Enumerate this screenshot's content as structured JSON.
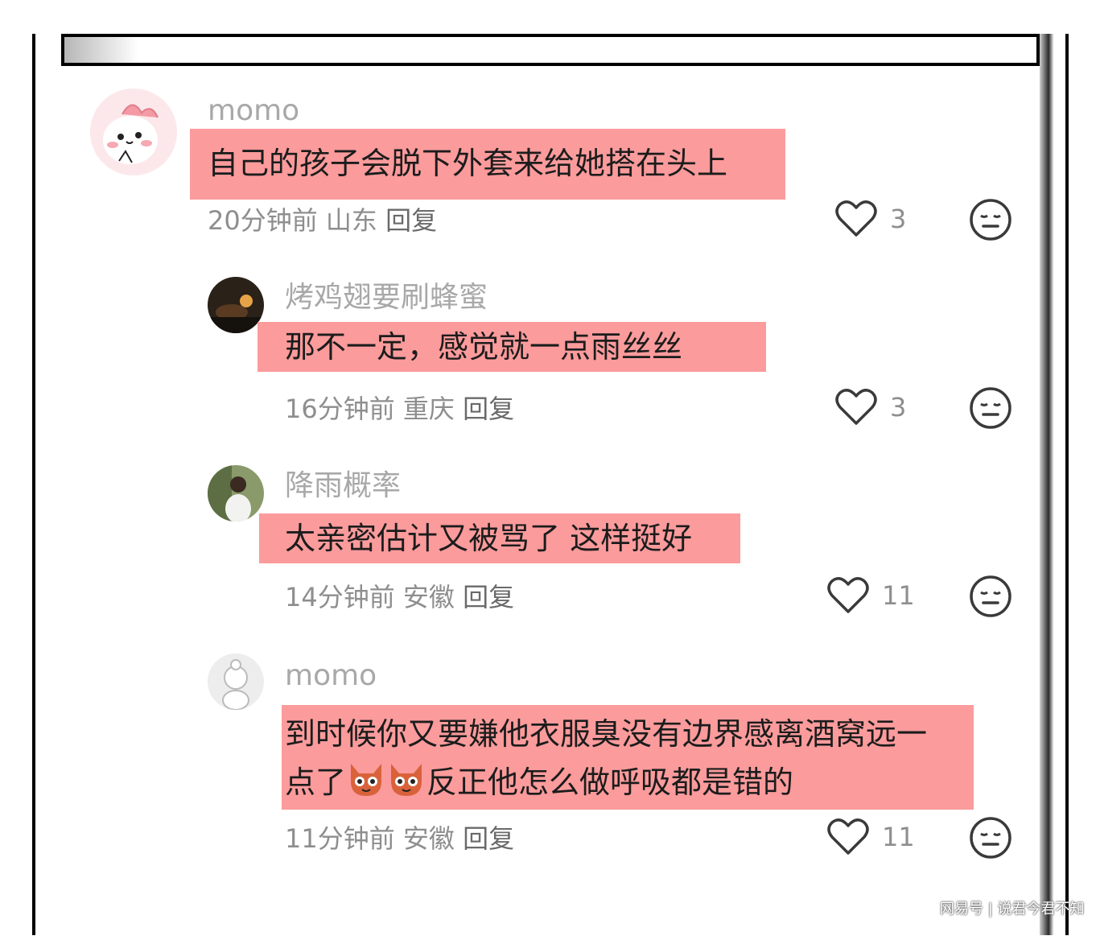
{
  "comments": [
    {
      "username": "momo",
      "body_lines": [
        "自己的孩子会脱下外套来给她搭在头上"
      ],
      "time": "20分钟前",
      "location": "山东",
      "reply_label": "回复",
      "likes": "3",
      "avatar_icon": "pink-cartoon-avatar"
    },
    {
      "username": "烤鸡翅要刷蜂蜜",
      "body_lines": [
        "那不一定，感觉就一点雨丝丝"
      ],
      "time": "16分钟前",
      "location": "重庆",
      "reply_label": "回复",
      "likes": "3",
      "avatar_icon": "night-photo-avatar"
    },
    {
      "username": "降雨概率",
      "body_lines": [
        "太亲密估计又被骂了 这样挺好"
      ],
      "time": "14分钟前",
      "location": "安徽",
      "reply_label": "回复",
      "likes": "11",
      "avatar_icon": "person-photo-avatar"
    },
    {
      "username": "momo",
      "body_lines": [
        "到时候你又要嫌他衣服臭没有边界感离酒窝远一",
        "点了",
        "反正他怎么做呼吸都是错的"
      ],
      "time": "11分钟前",
      "location": "安徽",
      "reply_label": "回复",
      "likes": "11",
      "avatar_icon": "gray-cartoon-avatar"
    }
  ],
  "watermark": "网易号 | 说君今君不知",
  "colors": {
    "highlight": "#fb9b9c",
    "username": "#a8a8a8",
    "meta": "#8e8e8e"
  }
}
